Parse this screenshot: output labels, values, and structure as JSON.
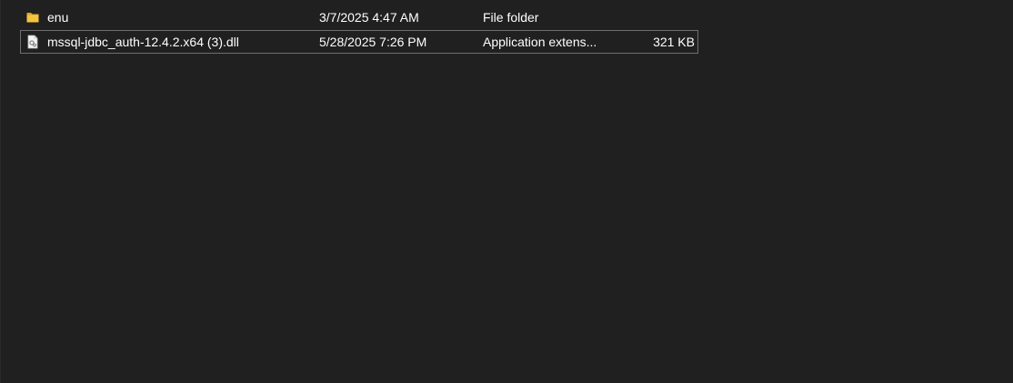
{
  "files": [
    {
      "icon": "folder-icon",
      "name": "enu",
      "date_modified": "3/7/2025 4:47 AM",
      "type": "File folder",
      "size": "",
      "selected": false
    },
    {
      "icon": "dll-file-icon",
      "name": "mssql-jdbc_auth-12.4.2.x64 (3).dll",
      "date_modified": "5/28/2025 7:26 PM",
      "type": "Application extens...",
      "size": "321 KB",
      "selected": true
    }
  ],
  "colors": {
    "background": "#202020",
    "text": "#ffffff",
    "folder": "#f3c53e",
    "selection_border": "#6f6f6f"
  }
}
